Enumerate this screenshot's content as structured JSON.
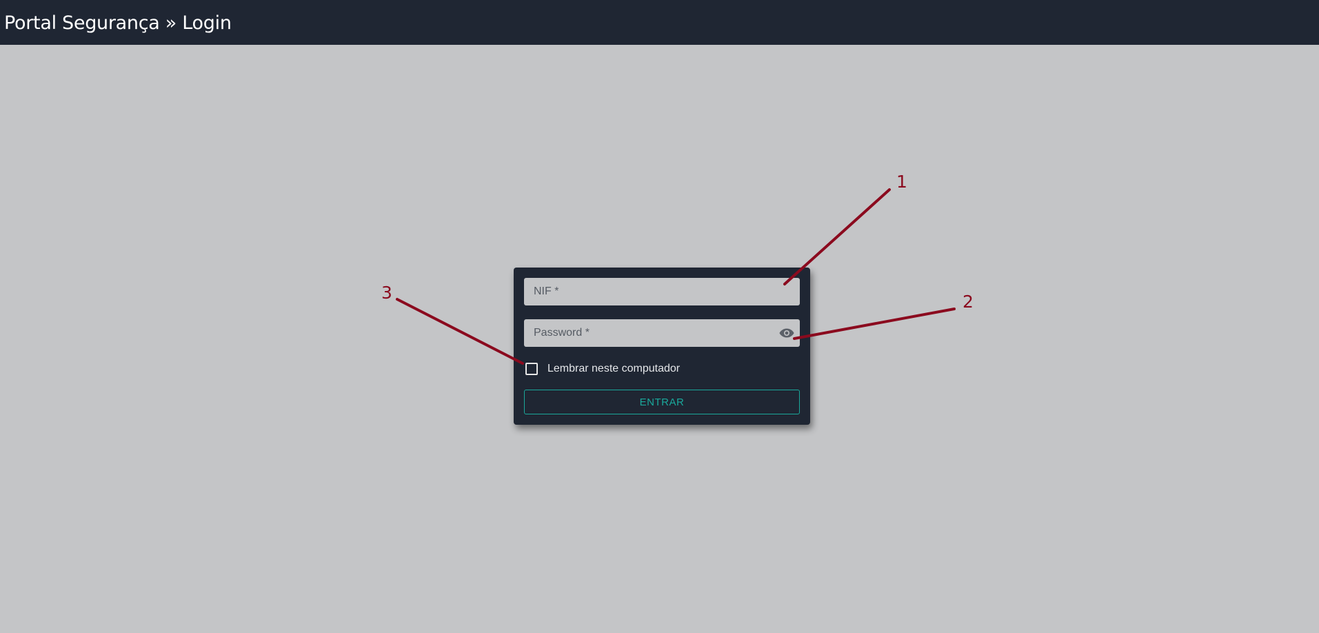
{
  "header": {
    "title": "Portal Segurança » Login"
  },
  "login_form": {
    "nif_placeholder": "NIF *",
    "password_placeholder": "Password *",
    "show_password_icon": "eye-icon",
    "remember_label": "Lembrar neste computador",
    "remember_checked": false,
    "submit_label": "ENTRAR"
  },
  "annotations": {
    "callout_1": "1",
    "callout_2": "2",
    "callout_3": "3"
  },
  "colors": {
    "header_bg": "#1f2633",
    "page_bg": "#c4c5c7",
    "card_bg": "#1f2633",
    "field_bg": "#c4c5c7",
    "accent": "#1aa89b",
    "annotation": "#8b0a1e"
  }
}
